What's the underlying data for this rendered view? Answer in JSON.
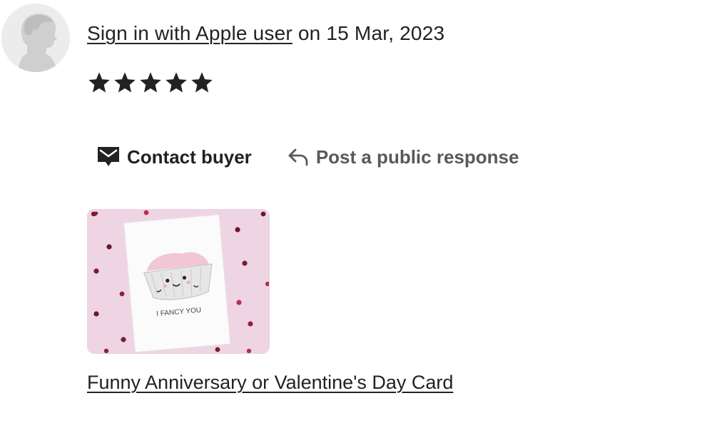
{
  "review": {
    "reviewer_name": "Sign in with Apple user",
    "date_text": "on 15 Mar, 2023",
    "rating": 5,
    "rating_max": 5
  },
  "actions": {
    "contact_label": "Contact buyer",
    "respond_label": "Post a public response"
  },
  "listing": {
    "title": "Funny Anniversary or Valentine's Day Card",
    "image_caption": "I FANCY YOU"
  },
  "colors": {
    "text": "#222222",
    "muted": "#595959",
    "thumb_background": "#efd5e3",
    "heart": "#8a1f35"
  },
  "icons": {
    "avatar": "default-avatar-icon",
    "star": "star-icon",
    "contact": "mail-icon",
    "respond": "reply-arrow-icon"
  }
}
